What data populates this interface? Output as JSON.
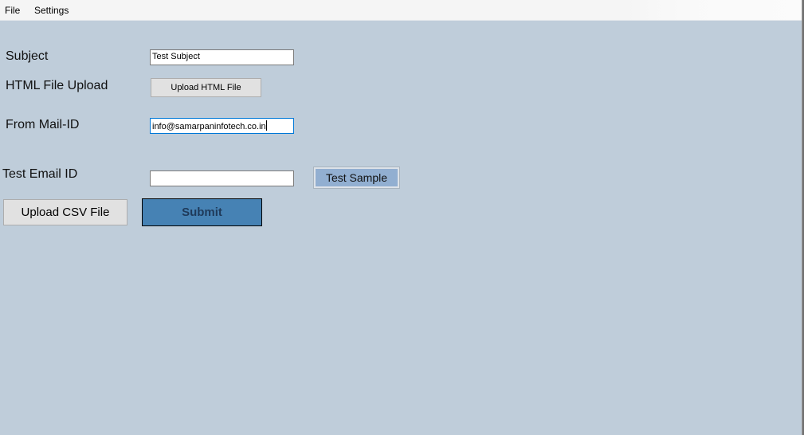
{
  "menu": {
    "items": [
      {
        "label": "File"
      },
      {
        "label": "Settings"
      }
    ]
  },
  "form": {
    "subject": {
      "label": "Subject",
      "value": "Test Subject"
    },
    "html_upload": {
      "label": "HTML File Upload",
      "button_label": "Upload HTML File"
    },
    "from_mail": {
      "label": "From Mail-ID",
      "value": "info@samarpaninfotech.co.in"
    },
    "test_email": {
      "label": "Test Email ID",
      "value": "",
      "button_label": "Test Sample"
    },
    "upload_csv": {
      "button_label": "Upload CSV File"
    },
    "submit": {
      "button_label": "Submit"
    }
  },
  "colors": {
    "background": "#bfcdda",
    "submit_button": "#4682b4",
    "test_sample_button": "#92afd1",
    "focus_border": "#0078d7"
  }
}
